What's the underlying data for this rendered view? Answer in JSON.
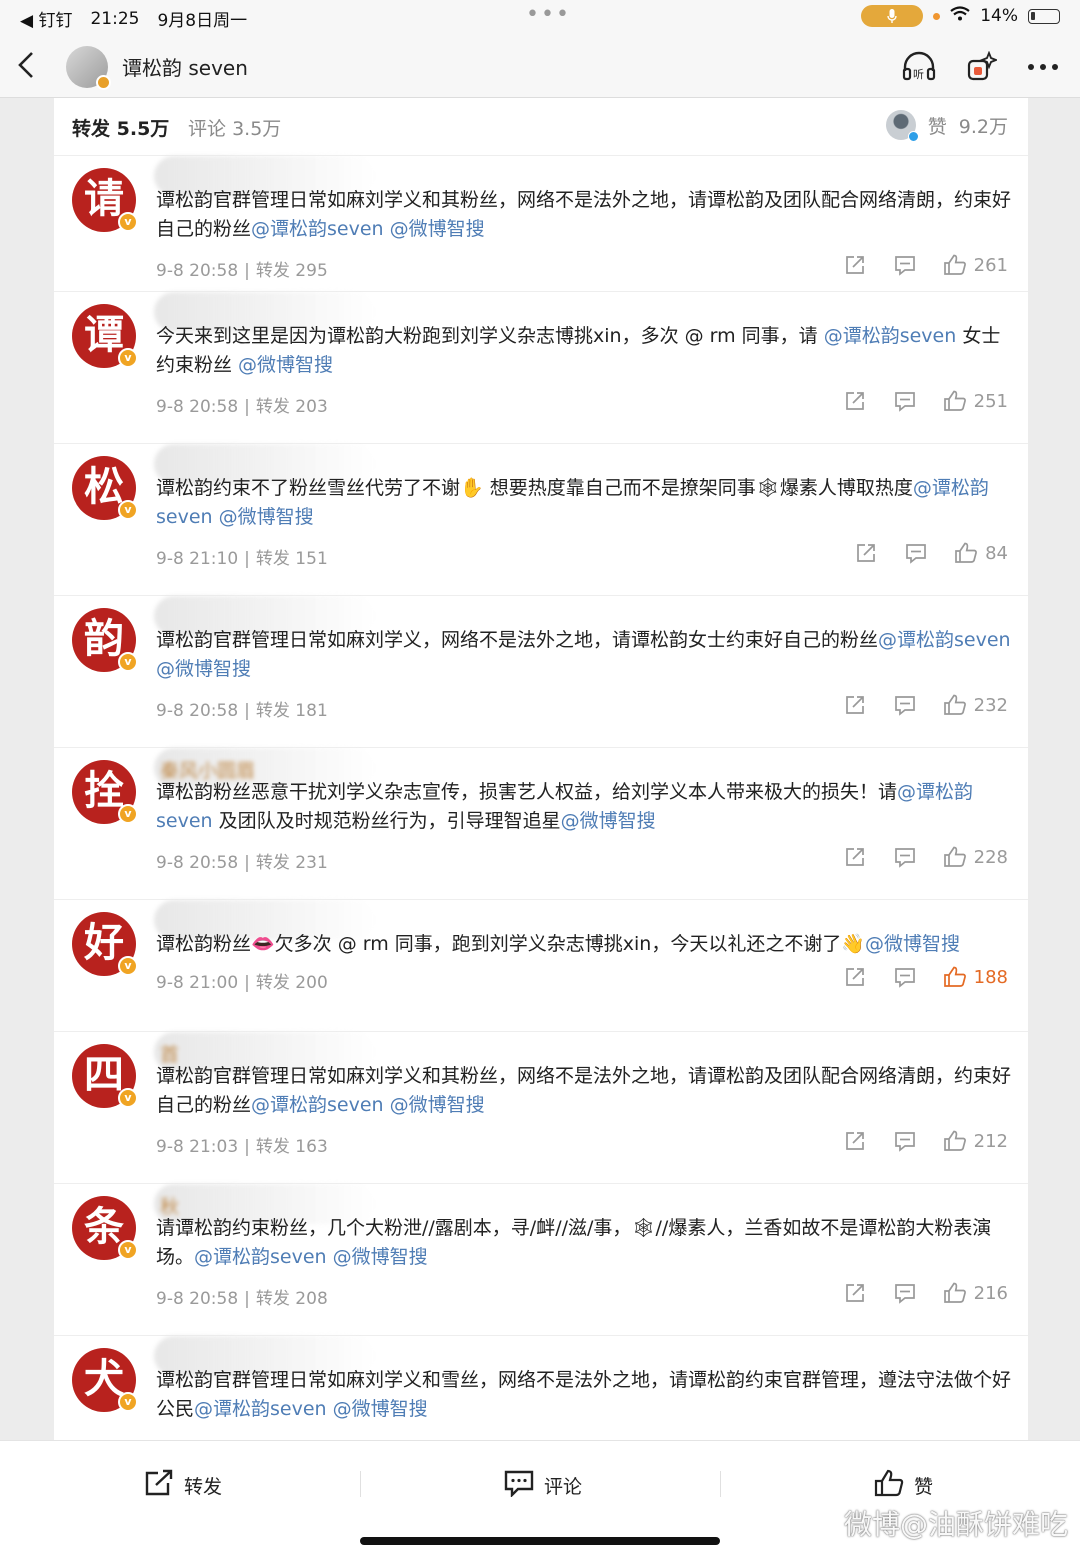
{
  "status_bar": {
    "back_app": "◀ 钉钉",
    "time": "21:25",
    "date": "9月8日周一",
    "battery": "14%"
  },
  "nav": {
    "title": "谭松韵 seven"
  },
  "tabs": {
    "repost_label": "转发",
    "repost_count": "5.5万",
    "comment_label": "评论",
    "comment_count": "3.5万",
    "like_label": "赞",
    "like_count": "9.2万"
  },
  "reposts": [
    {
      "avatar_char": "请",
      "username": "",
      "segments": [
        {
          "t": "谭松韵官群管理日常如麻刘学义和其粉丝，网络不是法外之地，请谭松韵及团队配合网络清朗，约束好自己的粉丝",
          "m": false
        },
        {
          "t": "@谭松韵seven",
          "m": true
        },
        {
          "t": " ",
          "m": false
        },
        {
          "t": "@微博智搜",
          "m": true
        }
      ],
      "time": "9-8 20:58",
      "repost": "转发 295",
      "likes": "261",
      "liked": false
    },
    {
      "avatar_char": "谭",
      "username": "",
      "segments": [
        {
          "t": "今天来到这里是因为谭松韵大粉跑到刘学义杂志博挑xin，多次 @ rm 同事，请 ",
          "m": false
        },
        {
          "t": "@谭松韵seven",
          "m": true
        },
        {
          "t": " 女士约束粉丝 ",
          "m": false
        },
        {
          "t": "@微博智搜",
          "m": true
        }
      ],
      "time": "9-8 20:58",
      "repost": "转发 203",
      "likes": "251",
      "liked": false
    },
    {
      "avatar_char": "松",
      "username": "",
      "segments": [
        {
          "t": "谭松韵约束不了粉丝雪丝代劳了不谢✋ 想要热度靠自己而不是撩架同事🕸爆素人博取热度",
          "m": false
        },
        {
          "t": "@谭松韵seven",
          "m": true
        },
        {
          "t": " ",
          "m": false
        },
        {
          "t": "@微博智搜",
          "m": true
        }
      ],
      "time": "9-8 21:10",
      "repost": "转发 151",
      "likes": "84",
      "liked": false
    },
    {
      "avatar_char": "韵",
      "username": "",
      "segments": [
        {
          "t": "谭松韵官群管理日常如麻刘学义，网络不是法外之地，请谭松韵女士约束好自己的粉丝",
          "m": false
        },
        {
          "t": "@谭松韵seven",
          "m": true
        },
        {
          "t": " ",
          "m": false
        },
        {
          "t": "@微博智搜",
          "m": true
        }
      ],
      "time": "9-8 20:58",
      "repost": "转发 181",
      "likes": "232",
      "liked": false
    },
    {
      "avatar_char": "拴",
      "username": "秦风小圆眉",
      "segments": [
        {
          "t": "谭松韵粉丝恶意干扰刘学义杂志宣传，损害艺人权益，给刘学义本人带来极大的损失！请",
          "m": false
        },
        {
          "t": "@谭松韵seven",
          "m": true
        },
        {
          "t": " 及团队及时规范粉丝行为，引导理智追星",
          "m": false
        },
        {
          "t": "@微博智搜",
          "m": true
        }
      ],
      "time": "9-8 20:58",
      "repost": "转发 231",
      "likes": "228",
      "liked": false
    },
    {
      "avatar_char": "好",
      "username": "",
      "segments": [
        {
          "t": "谭松韵粉丝👄欠多次 @ rm 同事，跑到刘学义杂志博挑xin，今天以礼还之不谢了👋",
          "m": false
        },
        {
          "t": "@微博智搜",
          "m": true
        }
      ],
      "time": "9-8 21:00",
      "repost": "转发 200",
      "likes": "188",
      "liked": true
    },
    {
      "avatar_char": "四",
      "username": "首",
      "segments": [
        {
          "t": "谭松韵官群管理日常如麻刘学义和其粉丝，网络不是法外之地，请谭松韵及团队配合网络清朗，约束好自己的粉丝",
          "m": false
        },
        {
          "t": "@谭松韵seven",
          "m": true
        },
        {
          "t": " ",
          "m": false
        },
        {
          "t": "@微博智搜",
          "m": true
        }
      ],
      "time": "9-8 21:03",
      "repost": "转发 163",
      "likes": "212",
      "liked": false
    },
    {
      "avatar_char": "条",
      "username": "秋",
      "segments": [
        {
          "t": "请谭松韵约束粉丝，几个大粉泄//露剧本，寻/衅//滋/事，🕸//爆素人，兰香如故不是谭松韵大粉表演场。",
          "m": false
        },
        {
          "t": "@谭松韵seven",
          "m": true
        },
        {
          "t": " ",
          "m": false
        },
        {
          "t": "@微博智搜",
          "m": true
        }
      ],
      "time": "9-8 20:58",
      "repost": "转发 208",
      "likes": "216",
      "liked": false
    },
    {
      "avatar_char": "犬",
      "username": "",
      "segments": [
        {
          "t": "谭松韵官群管理日常如麻刘学义和雪丝，网络不是法外之地，请谭松韵约束官群管理，遵法守法做个好公民",
          "m": false
        },
        {
          "t": "@谭松韵seven",
          "m": true
        },
        {
          "t": " ",
          "m": false
        },
        {
          "t": "@微博智搜",
          "m": true
        }
      ],
      "time": "",
      "repost": "",
      "likes": "",
      "liked": false
    }
  ],
  "bottom_bar": {
    "repost_label": "转发",
    "comment_label": "评论",
    "like_label": "赞"
  },
  "watermark": "微博@油酥饼难吃",
  "colors": {
    "accent_orange": "#e46a24",
    "mention_blue": "#4f7db5",
    "avatar_red": "#b8221e",
    "verified_gold": "#f0a423"
  }
}
